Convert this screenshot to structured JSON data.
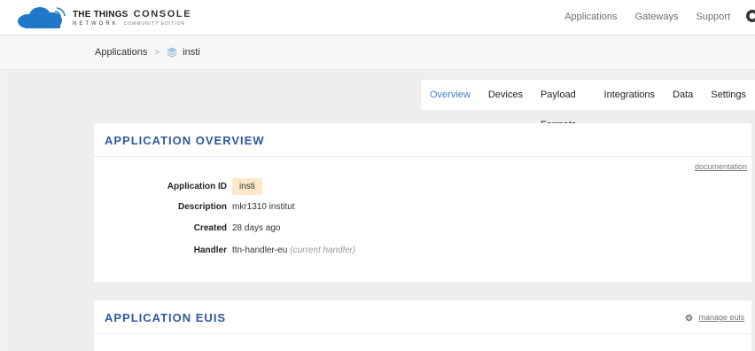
{
  "header": {
    "brand_top": "THE THINGS",
    "brand_console": "CONSOLE",
    "brand_bottom": "NETWORK",
    "brand_edition": "COMMUNITY EDITION",
    "nav": [
      "Applications",
      "Gateways",
      "Support"
    ]
  },
  "breadcrumb": {
    "root": "Applications",
    "separator": ">",
    "current": "insti"
  },
  "tabs": [
    "Overview",
    "Devices",
    "Payload Formats",
    "Integrations",
    "Data",
    "Settings"
  ],
  "active_tab": "Overview",
  "overview": {
    "title": "APPLICATION OVERVIEW",
    "documentation_link": "documentation",
    "rows": {
      "app_id_label": "Application ID",
      "app_id_value": "insti",
      "description_label": "Description",
      "description_value": "mkr1310 institut",
      "created_label": "Created",
      "created_value": "28 days ago",
      "handler_label": "Handler",
      "handler_value": "ttn-handler-eu",
      "handler_note": "(current handler)"
    }
  },
  "euis": {
    "title": "APPLICATION EUIS",
    "manage_label": "manage euis"
  },
  "colors": {
    "accent": "#3a7fd5",
    "title": "#2d5a9e",
    "badge_bg": "#fde9c9",
    "badge_fg": "#e49a3a"
  },
  "icons": [
    "ttn-cloud-logo-icon",
    "user-avatar-icon",
    "application-stack-icon",
    "gear-icon"
  ]
}
